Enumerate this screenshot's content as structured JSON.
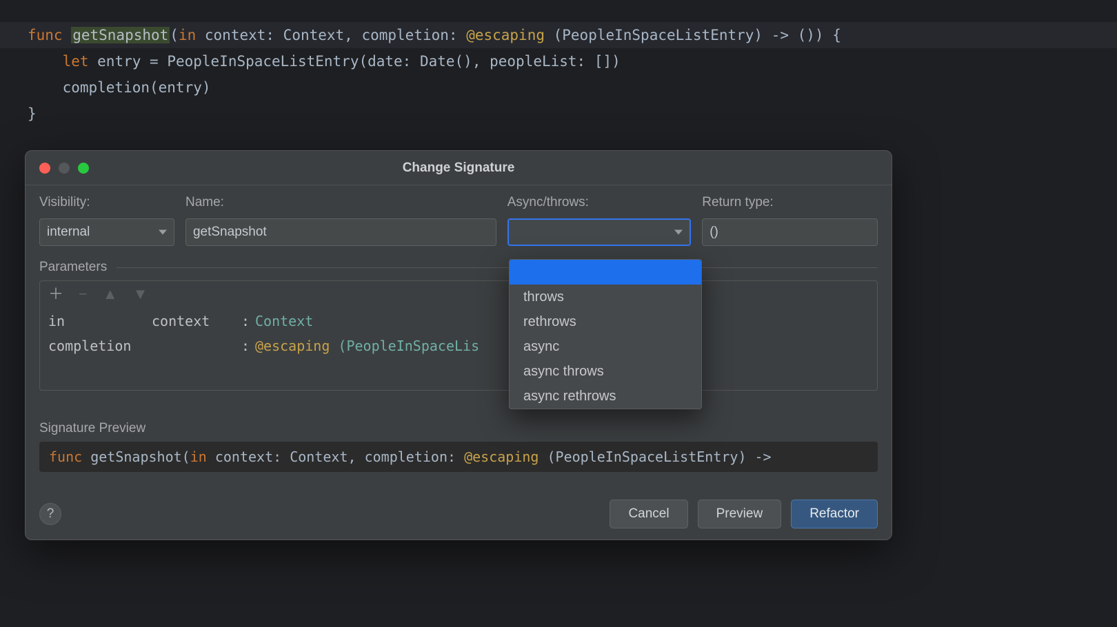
{
  "editor": {
    "lines": [
      {
        "spans": [
          {
            "t": "func ",
            "c": "kw-orange"
          },
          {
            "t": "getSnapshot",
            "c": "sel-fn"
          },
          {
            "t": "(",
            "c": "plain"
          },
          {
            "t": "in ",
            "c": "kw-orange"
          },
          {
            "t": "context: Context, completion: ",
            "c": "plain"
          },
          {
            "t": "@escaping",
            "c": "kw-yellow"
          },
          {
            "t": " (PeopleInSpaceListEntry) -> ()) {",
            "c": "plain"
          }
        ]
      },
      {
        "spans": [
          {
            "t": "    ",
            "c": "plain"
          },
          {
            "t": "let",
            "c": "kw-orange"
          },
          {
            "t": " entry = ",
            "c": "plain"
          },
          {
            "t": "PeopleInSpaceListEntry",
            "c": "plain"
          },
          {
            "t": "(date: Date(), peopleList: [])",
            "c": "plain"
          }
        ]
      },
      {
        "spans": [
          {
            "t": "    completion(entry)",
            "c": "plain"
          }
        ]
      },
      {
        "spans": [
          {
            "t": "}",
            "c": "plain"
          }
        ]
      }
    ]
  },
  "dialog": {
    "title": "Change Signature",
    "visibility_label": "Visibility:",
    "name_label": "Name:",
    "async_label": "Async/throws:",
    "return_label": "Return type:",
    "visibility_value": "internal",
    "name_value": "getSnapshot",
    "async_value": "",
    "return_value": "()",
    "parameters_label": "Parameters",
    "params": [
      {
        "ext": "in",
        "int": "context",
        "type_pre": "",
        "type": "Context"
      },
      {
        "ext": "completion",
        "int": "",
        "type_pre": "@escaping ",
        "type": "(PeopleInSpaceLis"
      }
    ],
    "sig_preview_label": "Signature Preview",
    "sig_preview_spans": [
      {
        "t": "func ",
        "c": "kw-orange"
      },
      {
        "t": "getSnapshot(",
        "c": "plain"
      },
      {
        "t": "in ",
        "c": "kw-orange"
      },
      {
        "t": "context: Context, completion: ",
        "c": "plain"
      },
      {
        "t": "@escaping",
        "c": "kw-yellow"
      },
      {
        "t": " (PeopleInSpaceListEntry) ->",
        "c": "plain"
      }
    ],
    "help": "?",
    "buttons": {
      "cancel": "Cancel",
      "preview": "Preview",
      "refactor": "Refactor"
    }
  },
  "dropdown": {
    "items": [
      "",
      "throws",
      "rethrows",
      "async",
      "async throws",
      "async rethrows"
    ],
    "selected_index": 0
  }
}
